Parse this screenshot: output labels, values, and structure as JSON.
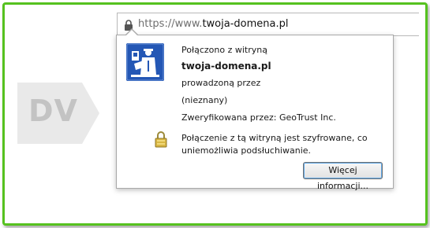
{
  "urlbar": {
    "lock_icon": "lock-icon",
    "protocol": "https://www.",
    "domain": "twoja-domena.pl"
  },
  "badge": {
    "label": "DV",
    "color": "#e9e9e9"
  },
  "popup": {
    "identity_icon": "site-identity-icon",
    "connected_to": "Połączono z witryną",
    "site": "twoja-domena.pl",
    "run_by": "prowadzoną przez",
    "owner": "(nieznany)",
    "verified_by": "Zweryfikowana przez: GeoTrust Inc.",
    "encryption_icon": "padlock-icon",
    "encryption_line1": "Połączenie z tą witryną jest szyfrowane, co",
    "encryption_line2": "uniemożliwia podsłuchiwanie.",
    "more_info_button": "Więcej informacji..."
  },
  "colors": {
    "frame_border": "#56c21f",
    "identity_icon_bg": "#2457b5"
  }
}
